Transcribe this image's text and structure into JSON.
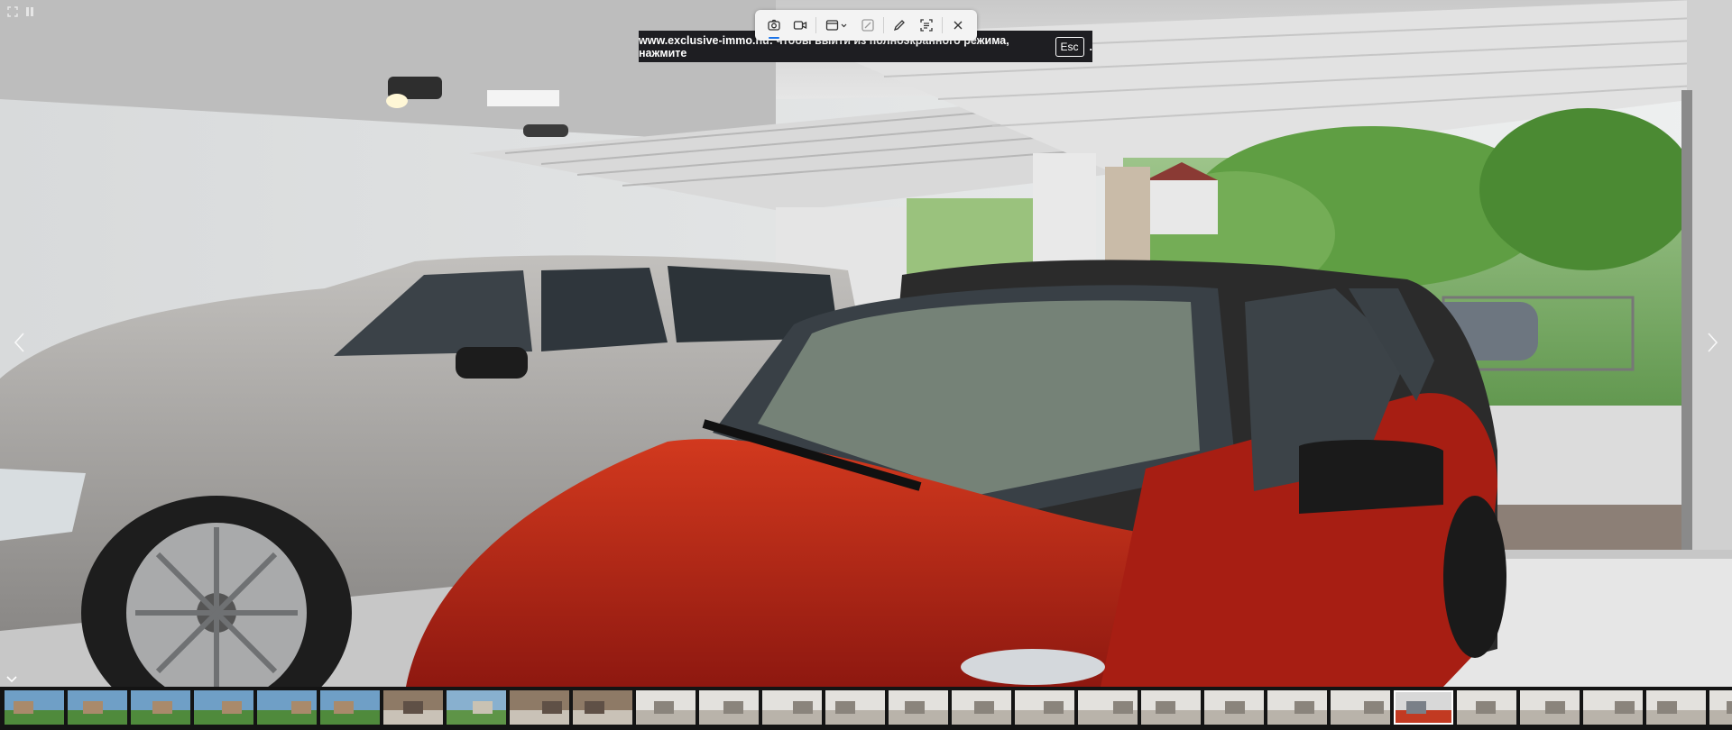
{
  "viewer": {
    "banner": {
      "text": "www.exclusive-immo.hu: чтобы выйти из полноэкранного режима, нажмите",
      "key": "Esc",
      "suffix": "."
    },
    "toolbar": {
      "buttons": [
        {
          "name": "screenshot",
          "icon": "camera-icon",
          "active": true
        },
        {
          "name": "record",
          "icon": "video-icon",
          "active": false
        },
        {
          "name": "window-mode",
          "icon": "window-dropdown-icon",
          "active": false
        },
        {
          "name": "markup",
          "icon": "edit-image-icon",
          "active": false
        },
        {
          "name": "pen",
          "icon": "pen-icon",
          "active": false
        },
        {
          "name": "text-scan",
          "icon": "scan-text-icon",
          "active": false
        },
        {
          "name": "close",
          "icon": "close-icon",
          "active": false
        }
      ]
    },
    "corner_icons": [
      "fullscreen-icon",
      "pause-icon"
    ],
    "thumbnails": {
      "count": 28,
      "selected_index": 22,
      "kinds": [
        "house",
        "house",
        "house",
        "house",
        "house",
        "house",
        "interior",
        "exterior",
        "interior",
        "interior",
        "room",
        "room",
        "room",
        "room",
        "room",
        "room",
        "room",
        "room",
        "room",
        "room",
        "room",
        "room",
        "garage",
        "room",
        "room",
        "room",
        "room",
        "room"
      ]
    }
  }
}
